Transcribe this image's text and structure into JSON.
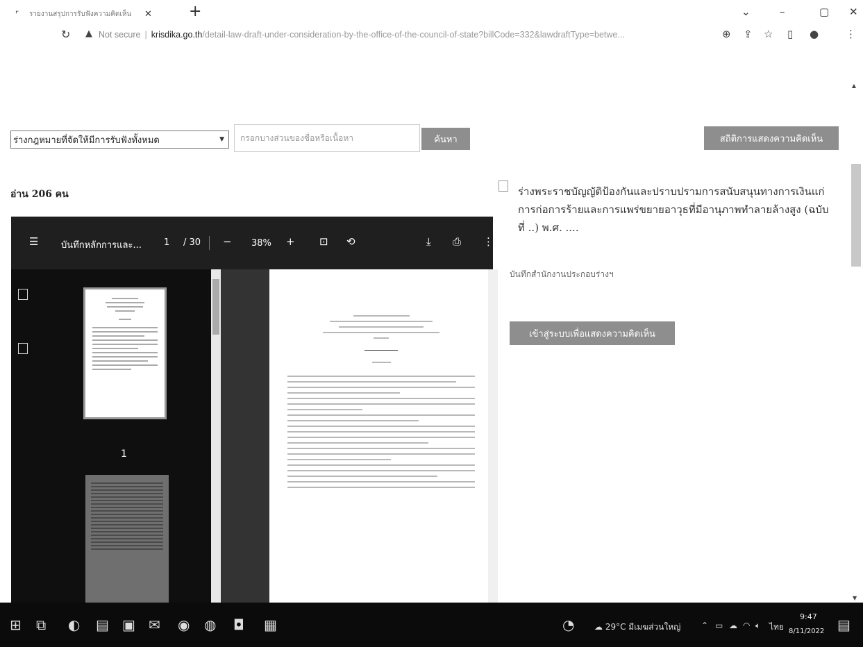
{
  "browser": {
    "tab_title": "รายงานสรุปการรับฟังความคิดเห็น",
    "url_warning": "Not secure",
    "url_domain": "krisdika.go.th",
    "url_path": "/detail-law-draft-under-consideration-by-the-office-of-the-council-of-state?billCode=332&lawdraftType=betwe..."
  },
  "search": {
    "filter_value": "ร่างกฎหมายที่จัดให้มีการรับฟังทั้งหมด",
    "placeholder": "กรอกบางส่วนของชื่อหรือเนื้อหา",
    "search_label": "ค้นหา",
    "stats_label": "สถิติการแสดงความคิดเห็น"
  },
  "read_count": "อ่าน 206 คน",
  "pdf_viewer": {
    "doc_title": "บันทึกหลักการและ...",
    "page_current": "1",
    "page_total": "/ 30",
    "zoom": "38%",
    "thumb_page_label": "1"
  },
  "law": {
    "title": "ร่างพระราชบัญญัติป้องกันและปราบปรามการสนับสนุนทางการเงินแก่การก่อการร้ายและการแพร่ขยายอาวุธที่มีอานุภาพทำลายล้างสูง (ฉบับที่ ..) พ.ศ. ....",
    "subtitle": "บันทึกสำนักงานประกอบร่างฯ",
    "login_button": "เข้าสู่ระบบเพื่อแสดงความคิดเห็น"
  },
  "taskbar": {
    "weather": "29°C มีเมฆส่วนใหญ่",
    "language": "ไทย",
    "time": "9:47",
    "date": "8/11/2022"
  },
  "icons": [
    "windows-icon",
    "task-view-icon",
    "edge-icon",
    "file-explorer-icon",
    "store-icon",
    "mail-icon",
    "app-icon",
    "chrome-icon",
    "line-icon",
    "word-icon"
  ]
}
